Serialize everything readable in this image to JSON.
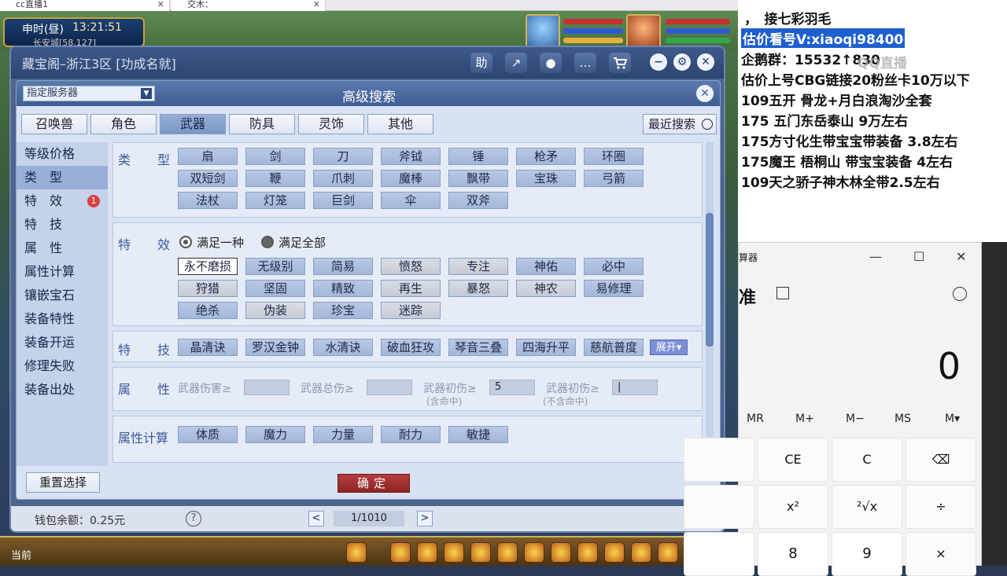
{
  "browser": {
    "tab1": "cc直播1",
    "tab2": "交木："
  },
  "game": {
    "time_label": "申时(昼)",
    "clock": "13:21:51",
    "location": "长安城[58,127]",
    "bottom_label": "当前"
  },
  "window": {
    "title": "藏宝阁–浙江3区 [功成名就]",
    "toolbar": {
      "help": "助",
      "share": "↗",
      "record": "●",
      "chat": "…",
      "cart": "🛒",
      "minimize": "−",
      "settings": "⚙",
      "close": "✕"
    }
  },
  "search": {
    "title": "高级搜索",
    "server_select": "指定服务器",
    "close": "✕",
    "categories": [
      "召唤兽",
      "角色",
      "武器",
      "防具",
      "灵饰",
      "其他"
    ],
    "active_category": "武器",
    "recent": "最近搜索",
    "side_menu": [
      "等级价格",
      "类　型",
      "特　效",
      "特　技",
      "属　性",
      "属性计算",
      "镶嵌宝石",
      "装备特性",
      "装备开运",
      "修理失败",
      "装备出处"
    ],
    "side_badge": "1",
    "type_section": {
      "label_a": "类",
      "label_b": "型",
      "items": [
        "扇",
        "剑",
        "刀",
        "斧钺",
        "锤",
        "枪矛",
        "环圈",
        "双短剑",
        "鞭",
        "爪刺",
        "魔棒",
        "飘带",
        "宝珠",
        "弓箭",
        "法杖",
        "灯笼",
        "巨剑",
        "伞",
        "双斧"
      ]
    },
    "effect_section": {
      "label_a": "特",
      "label_b": "效",
      "radio_any": "满足一种",
      "radio_all": "满足全部",
      "items": [
        "永不磨损",
        "无级别",
        "简易",
        "愤怒",
        "专注",
        "神佑",
        "必中",
        "狩猎",
        "坚固",
        "精致",
        "再生",
        "暴怒",
        "神农",
        "易修理",
        "绝杀",
        "伪装",
        "珍宝",
        "迷踪"
      ]
    },
    "skill_section": {
      "label_a": "特",
      "label_b": "技",
      "items": [
        "晶清诀",
        "罗汉金钟",
        "水清诀",
        "破血狂攻",
        "琴音三叠",
        "四海升平",
        "慈航普度"
      ],
      "expand": "展开▾"
    },
    "attr_section": {
      "label_a": "属",
      "label_b": "性",
      "f1_label": "武器伤害≥",
      "f1_value": "",
      "f2_label": "武器总伤≥",
      "f2_value": "",
      "f3_label": "武器初伤≥",
      "f3_sub": "(含命中)",
      "f3_value": "5",
      "f4_label": "武器初伤≥",
      "f4_sub": "(不含命中)",
      "f4_value": "|"
    },
    "calc_section": {
      "label": "属性计算",
      "items": [
        "体质",
        "魔力",
        "力量",
        "耐力",
        "敏捷"
      ]
    },
    "reset": "重置选择",
    "confirm": "确定"
  },
  "footer": {
    "wallet": "钱包余额：0.25元",
    "help": "?",
    "prev": "<",
    "page": "1/1010",
    "next": ">"
  },
  "notes": {
    "lines": [
      "，　接七彩羽毛",
      "估价看号V:xiaoqi98400",
      "企鹅群：15532↑830",
      "估价上号CBG链接20粉丝卡10万以下",
      "109五开 骨龙+月白浪淘沙全套",
      "175 五门东岳泰山 9万左右",
      "175方寸化生带宝宝带装备 3.8左右",
      "175魔王 梧桐山 带宝宝装备 4左右",
      "109天之骄子神木林全带2.5左右"
    ],
    "watermark": "QQ直播"
  },
  "calculator": {
    "title": "算器",
    "mode": "准",
    "display": "0",
    "memory": [
      "MR",
      "M+",
      "M−",
      "MS",
      "M▾"
    ],
    "keys_row1": [
      "",
      "CE",
      "C",
      "⌫"
    ],
    "keys_row2": [
      "",
      "x²",
      "²√x",
      "÷"
    ],
    "keys_row3": [
      "",
      "8",
      "9",
      "×"
    ],
    "ctrl_min": "—",
    "ctrl_max": "☐",
    "ctrl_close": "✕"
  },
  "colors": {
    "panel": "#d8e2f2",
    "chip": "#a3b7db",
    "accent_red": "#b43c3c",
    "highlight": "#1e5fd0"
  }
}
